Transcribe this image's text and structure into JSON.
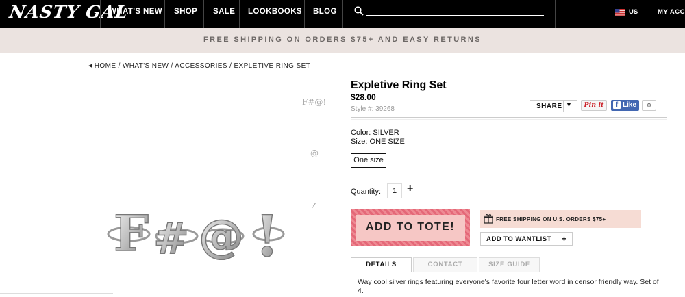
{
  "header": {
    "logo_text": "NASTY GAL",
    "nav": [
      "WHAT'S NEW",
      "SHOP",
      "SALE",
      "LOOKBOOKS",
      "BLOG"
    ],
    "search_placeholder": "",
    "region": "US",
    "account": "MY ACC"
  },
  "promo": {
    "text": "FREE SHIPPING ON ORDERS $75+ AND EASY RETURNS"
  },
  "breadcrumb": {
    "text": "HOME / WHAT'S NEW / ACCESSORIES / EXPLETIVE RING SET"
  },
  "gallery": {
    "thumbnails": [
      "F#@!",
      "@",
      "!"
    ],
    "main_rings": [
      "F",
      "#",
      "@",
      "!"
    ]
  },
  "product": {
    "title": "Expletive Ring Set",
    "price": "$28.00",
    "style": "Style #: 39268",
    "color": "Color:  SILVER",
    "size": "Size:  ONE SIZE",
    "size_option": "One size",
    "quantity_label": "Quantity:",
    "quantity": "1",
    "quantity_plus": "+",
    "add_to_tote": "ADD TO TOTE!",
    "free_shipping": "FREE SHIPPING ON U.S. ORDERS $75+",
    "wantlist": "ADD TO WANTLIST",
    "wantlist_plus": "+"
  },
  "social": {
    "share": "SHARE",
    "pinit": "Pin it",
    "like": "Like",
    "like_count": "0"
  },
  "tabs": {
    "details": "DETAILS",
    "contact": "CONTACT",
    "size_guide": "SIZE GUIDE"
  },
  "description": "Way cool silver rings featuring everyone's favorite four letter word in censor friendly way. Set of 4.",
  "colors": {
    "topbar": "#000000",
    "promo_bg": "#ebe3e0",
    "tote": "#e9727f",
    "tote_inner": "#f6c7c5",
    "ship_bg": "#f6dcd4",
    "facebook": "#4267b2",
    "pinterest": "#cb2027"
  }
}
